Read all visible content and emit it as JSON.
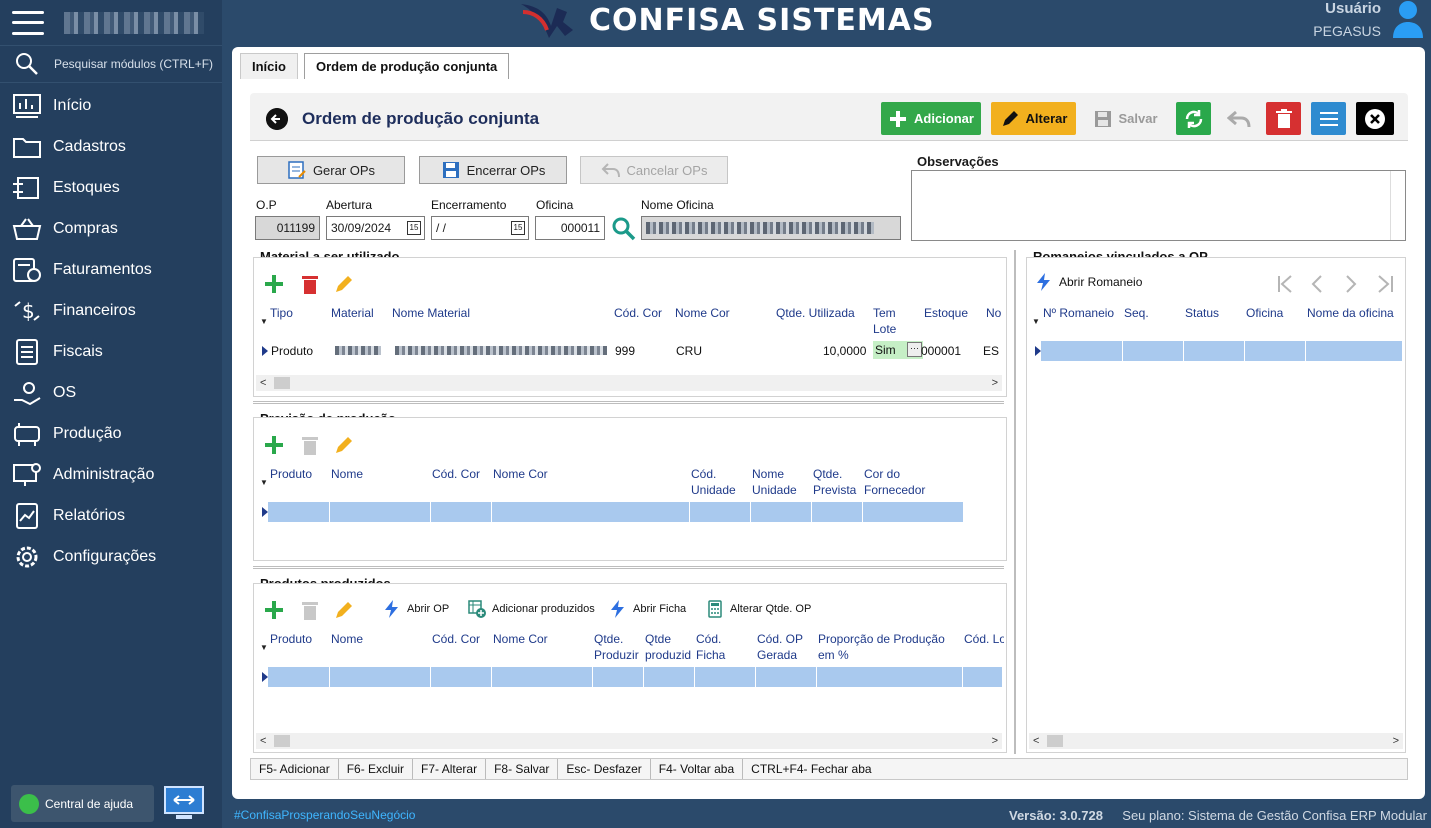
{
  "sidebar": {
    "search_placeholder": "Pesquisar módulos (CTRL+F)",
    "items": [
      {
        "label": "Início",
        "icon": "dashboard-icon"
      },
      {
        "label": "Cadastros",
        "icon": "folder-icon"
      },
      {
        "label": "Estoques",
        "icon": "box-arrows-icon"
      },
      {
        "label": "Compras",
        "icon": "basket-icon"
      },
      {
        "label": "Faturamentos",
        "icon": "invoice-icon"
      },
      {
        "label": "Financeiros",
        "icon": "dollar-arrows-icon"
      },
      {
        "label": "Fiscais",
        "icon": "list-document-icon"
      },
      {
        "label": "OS",
        "icon": "hand-gear-icon"
      },
      {
        "label": "Produção",
        "icon": "machine-icon"
      },
      {
        "label": "Administração",
        "icon": "monitor-gear-icon"
      },
      {
        "label": "Relatórios",
        "icon": "chart-document-icon"
      },
      {
        "label": "Configurações",
        "icon": "gear-icon"
      }
    ],
    "help_label": "Central de ajuda"
  },
  "header": {
    "brand": "CONFISA SISTEMAS",
    "user_label": "Usuário",
    "user_name": "PEGASUS"
  },
  "tabs": [
    "Início",
    "Ordem de produção conjunta"
  ],
  "form": {
    "title": "Ordem de produção conjunta",
    "toolbar": {
      "add": "Adicionar",
      "edit": "Alterar",
      "save": "Salvar"
    },
    "actions": {
      "generate": "Gerar OPs",
      "close": "Encerrar OPs",
      "cancel": "Cancelar OPs"
    },
    "fields": {
      "op_label": "O.P",
      "op_value": "011199",
      "opening_label": "Abertura",
      "opening_value": "30/09/2024",
      "closing_label": "Encerramento",
      "closing_value": " /  /",
      "workshop_label": "Oficina",
      "workshop_value": "000011",
      "workshop_name_label": "Nome Oficina"
    },
    "observations_label": "Observações"
  },
  "material": {
    "title": "Material a ser utilizado",
    "headers": [
      "Tipo",
      "Material",
      "Nome Material",
      "Cód. Cor",
      "Nome Cor",
      "Qtde. Utilizada",
      "Tem Lote",
      "Estoque",
      "No"
    ],
    "row": {
      "tipo": "Produto",
      "cod_cor": "999",
      "nome_cor": "CRU",
      "qtde": "10,0000",
      "tem_lote": "Sim",
      "estoque": "000001",
      "no": "ES"
    }
  },
  "forecast": {
    "title": "Previsão de produção",
    "headers": [
      "Produto",
      "Nome",
      "Cód. Cor",
      "Nome Cor",
      "Cód. Unidade",
      "Nome Unidade",
      "Qtde. Prevista",
      "Cor do Fornecedor"
    ]
  },
  "produced": {
    "title": "Produtos produzidos",
    "tools": {
      "open_op": "Abrir OP",
      "add_produced": "Adicionar produzidos",
      "open_sheet": "Abrir Ficha",
      "change_qty": "Alterar Qtde. OP"
    },
    "headers": [
      "Produto",
      "Nome",
      "Cód. Cor",
      "Nome Cor",
      "Qtde. Produzir",
      "Qtde produzid",
      "Cód. Ficha",
      "Cód. OP Gerada",
      "Proporção de Produção em %",
      "Cód. Lo"
    ]
  },
  "romaneios": {
    "title": "Romaneios vinculados a OP",
    "open_label": "Abrir Romaneio",
    "headers": [
      "Nº Romaneio",
      "Seq.",
      "Status",
      "Oficina",
      "Nome da oficina"
    ]
  },
  "shortcuts": [
    "F5- Adicionar",
    "F6- Excluir",
    "F7- Alterar",
    "F8- Salvar",
    "Esc- Desfazer",
    "F4- Voltar aba",
    "CTRL+F4- Fechar aba"
  ],
  "footer": {
    "hashtag": "#ConfisaProsperandoSeuNegócio",
    "version": "Versão: 3.0.728",
    "plan": "Seu plano: Sistema de Gestão Confisa ERP Modular"
  }
}
